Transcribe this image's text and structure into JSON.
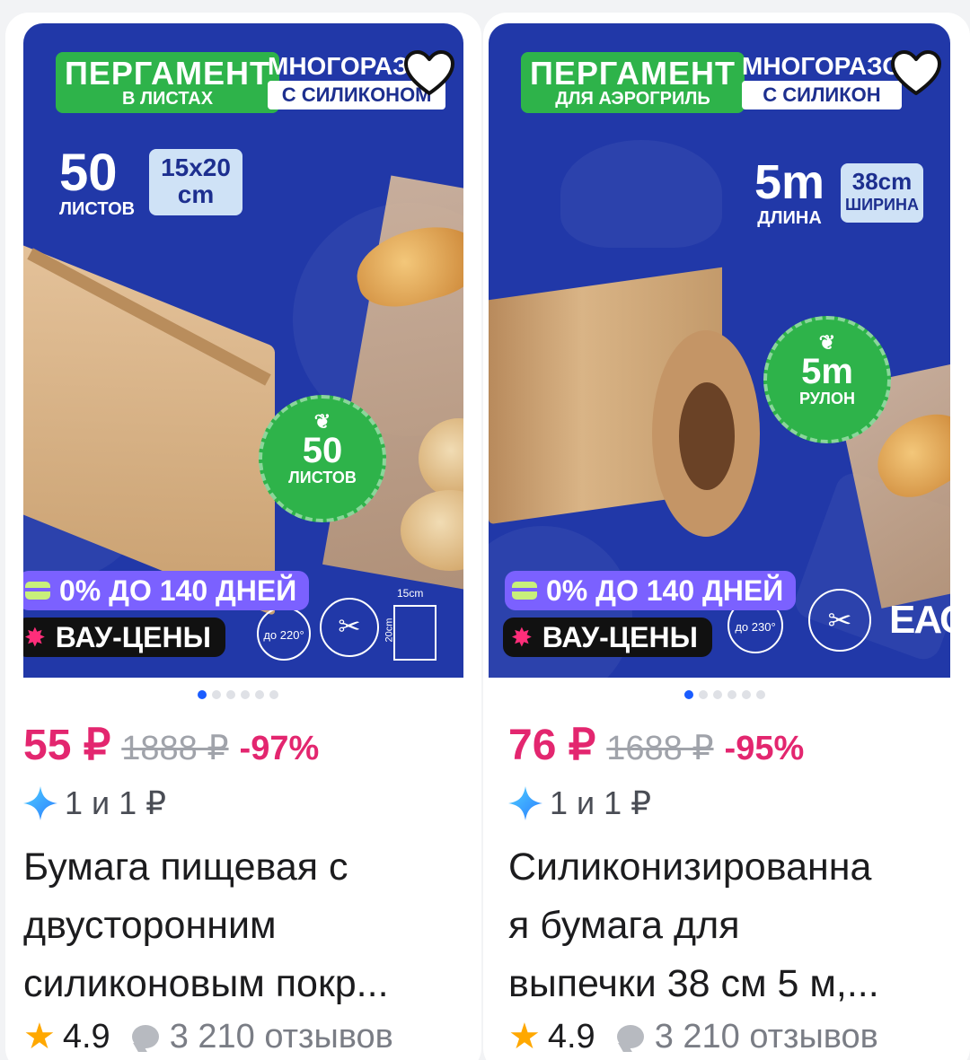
{
  "products": [
    {
      "image": {
        "label_main": "ПЕРГАМЕНТ",
        "label_sub": "В ЛИСТАХ",
        "reuse_top": "МНОГОРАЗОВ",
        "reuse_bottom": "С СИЛИКОНОМ",
        "count_number": "50",
        "count_caption": "ЛИСТОВ",
        "size_line1": "15x20",
        "size_line2": "cm",
        "circle_number": "50",
        "circle_caption": "ЛИСТОВ",
        "promo_installment": "0% ДО 140 ДНЕЙ",
        "promo_wow": "ВАУ-ЦЕНЫ",
        "temp_label": "до 220°",
        "dim_width": "15cm",
        "dim_height": "20cm",
        "total_images": 6,
        "active_image": 0
      },
      "price": "55 ₽",
      "old_price": "1888 ₽",
      "discount": "-97%",
      "bonus": "1 и 1 ₽",
      "title_lines": [
        "Бумага пищевая с",
        "двусторонним",
        "силиконовым покр..."
      ],
      "rating": "4.9",
      "reviews": "3 210 отзывов"
    },
    {
      "image": {
        "label_main": "ПЕРГАМЕНТ",
        "label_sub": "ДЛЯ АЭРОГРИЛЬ",
        "reuse_top": "МНОГОРАЗО",
        "reuse_bottom": "С СИЛИКОН",
        "count_number": "5m",
        "count_caption": "ДЛИНА",
        "size_line1": "38cm",
        "size_line2": "ШИРИНА",
        "circle_number": "5m",
        "circle_caption": "РУЛОН",
        "promo_installment": "0% ДО 140 ДНЕЙ",
        "promo_wow": "ВАУ-ЦЕНЫ",
        "temp_label": "до 230°",
        "cert": "ЕАС",
        "total_images": 6,
        "active_image": 0
      },
      "price": "76 ₽",
      "old_price": "1688 ₽",
      "discount": "-95%",
      "bonus": "1 и 1 ₽",
      "title_lines": [
        "Силиконизированна",
        "я бумага для",
        "выпечки 38 см 5 м,..."
      ],
      "rating": "4.9",
      "reviews": "3 210 отзывов"
    }
  ],
  "colors": {
    "accent_price": "#e3266f",
    "image_bg": "#2138a8",
    "green_badge": "#2eb34a",
    "promo_purple": "#7b61ff",
    "active_dot": "#1a5cff",
    "star": "#ffa800"
  },
  "icons": [
    "heart-outline-icon",
    "sparkle-diamond-icon",
    "star-icon",
    "comment-bubble-icon",
    "installment-card-icon",
    "wow-spark-icon",
    "scissors-icon",
    "leaf-icon"
  ]
}
